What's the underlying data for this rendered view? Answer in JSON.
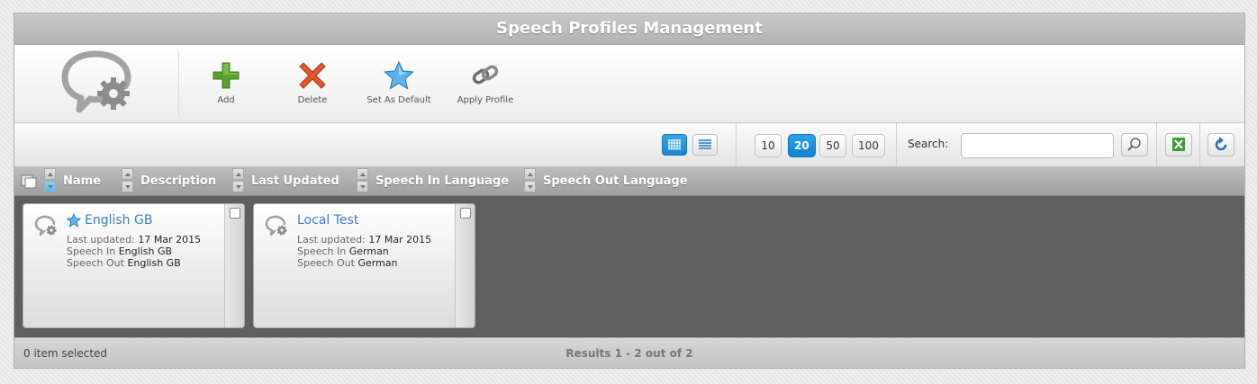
{
  "window": {
    "title": "Speech Profiles Management"
  },
  "toolbar": {
    "buttons": [
      {
        "label": "Add",
        "icon": "add-icon"
      },
      {
        "label": "Delete",
        "icon": "delete-icon"
      },
      {
        "label": "Set As Default",
        "icon": "star-icon"
      },
      {
        "label": "Apply Profile",
        "icon": "link-icon"
      }
    ]
  },
  "view": {
    "mode": "grid"
  },
  "pager": {
    "sizes": [
      "10",
      "20",
      "50",
      "100"
    ],
    "selected": "20"
  },
  "search": {
    "label": "Search:",
    "value": "",
    "placeholder": ""
  },
  "columns": [
    "Name",
    "Description",
    "Last Updated",
    "Speech In Language",
    "Speech Out Language"
  ],
  "cards": [
    {
      "name": "English GB",
      "is_default": true,
      "updated_label": "Last updated:",
      "updated": "17 Mar 2015",
      "in_label": "Speech In",
      "speech_in": "English GB",
      "out_label": "Speech Out",
      "speech_out": "English GB"
    },
    {
      "name": "Local Test",
      "is_default": false,
      "updated_label": "Last updated:",
      "updated": "17 Mar 2015",
      "in_label": "Speech In",
      "speech_in": "German",
      "out_label": "Speech Out",
      "speech_out": "German"
    }
  ],
  "footer": {
    "selected": "0 item selected",
    "results": "Results 1 - 2 out of 2"
  },
  "colors": {
    "accent": "#1a86cf",
    "title_link": "#3a7fc2",
    "content_bg": "#5f5f5f",
    "header_bg": "#b3b3b3"
  }
}
